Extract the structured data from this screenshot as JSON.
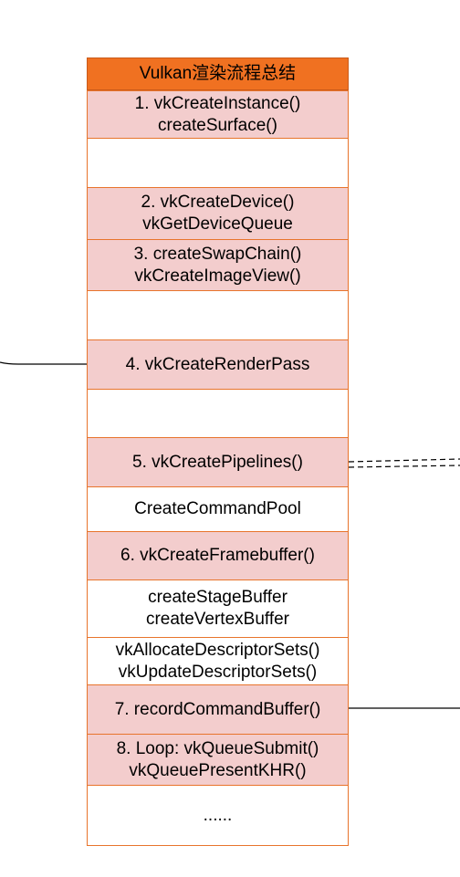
{
  "diagram": {
    "title": "Vulkan渲染流程总结",
    "rows": [
      {
        "id": "row-1",
        "fill": "pink",
        "lines": [
          "1. vkCreateInstance()",
          "createSurface()"
        ]
      },
      {
        "id": "row-blank-1",
        "fill": "white",
        "lines": []
      },
      {
        "id": "row-2",
        "fill": "pink",
        "lines": [
          "2. vkCreateDevice()",
          "vkGetDeviceQueue"
        ]
      },
      {
        "id": "row-3",
        "fill": "pink",
        "lines": [
          "3. createSwapChain()",
          "vkCreateImageView()"
        ]
      },
      {
        "id": "row-blank-2",
        "fill": "white",
        "lines": []
      },
      {
        "id": "row-4",
        "fill": "pink",
        "lines": [
          "4. vkCreateRenderPass"
        ]
      },
      {
        "id": "row-blank-3",
        "fill": "white",
        "lines": []
      },
      {
        "id": "row-5",
        "fill": "pink",
        "lines": [
          "5. vkCreatePipelines()"
        ]
      },
      {
        "id": "row-command-pool",
        "fill": "white",
        "lines": [
          "CreateCommandPool"
        ]
      },
      {
        "id": "row-6",
        "fill": "pink",
        "lines": [
          "6. vkCreateFramebuffer()"
        ]
      },
      {
        "id": "row-buffers",
        "fill": "white",
        "lines": [
          "createStageBuffer",
          "createVertexBuffer"
        ]
      },
      {
        "id": "row-descriptors",
        "fill": "white",
        "lines": [
          "vkAllocateDescriptorSets()",
          "vkUpdateDescriptorSets()"
        ]
      },
      {
        "id": "row-7",
        "fill": "pink",
        "lines": [
          "7. recordCommandBuffer()"
        ]
      },
      {
        "id": "row-8",
        "fill": "pink",
        "lines": [
          "8.  Loop: vkQueueSubmit()",
          "vkQueuePresentKHR()"
        ]
      },
      {
        "id": "row-ellipsis",
        "fill": "white",
        "lines": [
          "......"
        ]
      }
    ]
  },
  "colors": {
    "header_fill": "#f07121",
    "pink_fill": "#f3cdcd",
    "white_fill": "#ffffff",
    "border": "#e8742c",
    "connector": "#000000"
  }
}
